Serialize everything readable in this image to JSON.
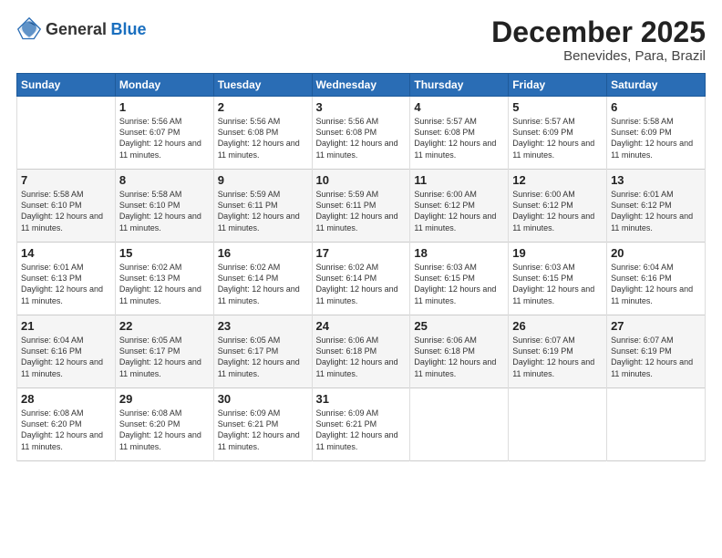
{
  "header": {
    "logo": {
      "general": "General",
      "blue": "Blue"
    },
    "title": "December 2025",
    "subtitle": "Benevides, Para, Brazil"
  },
  "calendar": {
    "weekdays": [
      "Sunday",
      "Monday",
      "Tuesday",
      "Wednesday",
      "Thursday",
      "Friday",
      "Saturday"
    ],
    "weeks": [
      [
        {
          "day": "",
          "sunrise": "",
          "sunset": "",
          "daylight": ""
        },
        {
          "day": "1",
          "sunrise": "Sunrise: 5:56 AM",
          "sunset": "Sunset: 6:07 PM",
          "daylight": "Daylight: 12 hours and 11 minutes."
        },
        {
          "day": "2",
          "sunrise": "Sunrise: 5:56 AM",
          "sunset": "Sunset: 6:08 PM",
          "daylight": "Daylight: 12 hours and 11 minutes."
        },
        {
          "day": "3",
          "sunrise": "Sunrise: 5:56 AM",
          "sunset": "Sunset: 6:08 PM",
          "daylight": "Daylight: 12 hours and 11 minutes."
        },
        {
          "day": "4",
          "sunrise": "Sunrise: 5:57 AM",
          "sunset": "Sunset: 6:08 PM",
          "daylight": "Daylight: 12 hours and 11 minutes."
        },
        {
          "day": "5",
          "sunrise": "Sunrise: 5:57 AM",
          "sunset": "Sunset: 6:09 PM",
          "daylight": "Daylight: 12 hours and 11 minutes."
        },
        {
          "day": "6",
          "sunrise": "Sunrise: 5:58 AM",
          "sunset": "Sunset: 6:09 PM",
          "daylight": "Daylight: 12 hours and 11 minutes."
        }
      ],
      [
        {
          "day": "7",
          "sunrise": "Sunrise: 5:58 AM",
          "sunset": "Sunset: 6:10 PM",
          "daylight": "Daylight: 12 hours and 11 minutes."
        },
        {
          "day": "8",
          "sunrise": "Sunrise: 5:58 AM",
          "sunset": "Sunset: 6:10 PM",
          "daylight": "Daylight: 12 hours and 11 minutes."
        },
        {
          "day": "9",
          "sunrise": "Sunrise: 5:59 AM",
          "sunset": "Sunset: 6:11 PM",
          "daylight": "Daylight: 12 hours and 11 minutes."
        },
        {
          "day": "10",
          "sunrise": "Sunrise: 5:59 AM",
          "sunset": "Sunset: 6:11 PM",
          "daylight": "Daylight: 12 hours and 11 minutes."
        },
        {
          "day": "11",
          "sunrise": "Sunrise: 6:00 AM",
          "sunset": "Sunset: 6:12 PM",
          "daylight": "Daylight: 12 hours and 11 minutes."
        },
        {
          "day": "12",
          "sunrise": "Sunrise: 6:00 AM",
          "sunset": "Sunset: 6:12 PM",
          "daylight": "Daylight: 12 hours and 11 minutes."
        },
        {
          "day": "13",
          "sunrise": "Sunrise: 6:01 AM",
          "sunset": "Sunset: 6:12 PM",
          "daylight": "Daylight: 12 hours and 11 minutes."
        }
      ],
      [
        {
          "day": "14",
          "sunrise": "Sunrise: 6:01 AM",
          "sunset": "Sunset: 6:13 PM",
          "daylight": "Daylight: 12 hours and 11 minutes."
        },
        {
          "day": "15",
          "sunrise": "Sunrise: 6:02 AM",
          "sunset": "Sunset: 6:13 PM",
          "daylight": "Daylight: 12 hours and 11 minutes."
        },
        {
          "day": "16",
          "sunrise": "Sunrise: 6:02 AM",
          "sunset": "Sunset: 6:14 PM",
          "daylight": "Daylight: 12 hours and 11 minutes."
        },
        {
          "day": "17",
          "sunrise": "Sunrise: 6:02 AM",
          "sunset": "Sunset: 6:14 PM",
          "daylight": "Daylight: 12 hours and 11 minutes."
        },
        {
          "day": "18",
          "sunrise": "Sunrise: 6:03 AM",
          "sunset": "Sunset: 6:15 PM",
          "daylight": "Daylight: 12 hours and 11 minutes."
        },
        {
          "day": "19",
          "sunrise": "Sunrise: 6:03 AM",
          "sunset": "Sunset: 6:15 PM",
          "daylight": "Daylight: 12 hours and 11 minutes."
        },
        {
          "day": "20",
          "sunrise": "Sunrise: 6:04 AM",
          "sunset": "Sunset: 6:16 PM",
          "daylight": "Daylight: 12 hours and 11 minutes."
        }
      ],
      [
        {
          "day": "21",
          "sunrise": "Sunrise: 6:04 AM",
          "sunset": "Sunset: 6:16 PM",
          "daylight": "Daylight: 12 hours and 11 minutes."
        },
        {
          "day": "22",
          "sunrise": "Sunrise: 6:05 AM",
          "sunset": "Sunset: 6:17 PM",
          "daylight": "Daylight: 12 hours and 11 minutes."
        },
        {
          "day": "23",
          "sunrise": "Sunrise: 6:05 AM",
          "sunset": "Sunset: 6:17 PM",
          "daylight": "Daylight: 12 hours and 11 minutes."
        },
        {
          "day": "24",
          "sunrise": "Sunrise: 6:06 AM",
          "sunset": "Sunset: 6:18 PM",
          "daylight": "Daylight: 12 hours and 11 minutes."
        },
        {
          "day": "25",
          "sunrise": "Sunrise: 6:06 AM",
          "sunset": "Sunset: 6:18 PM",
          "daylight": "Daylight: 12 hours and 11 minutes."
        },
        {
          "day": "26",
          "sunrise": "Sunrise: 6:07 AM",
          "sunset": "Sunset: 6:19 PM",
          "daylight": "Daylight: 12 hours and 11 minutes."
        },
        {
          "day": "27",
          "sunrise": "Sunrise: 6:07 AM",
          "sunset": "Sunset: 6:19 PM",
          "daylight": "Daylight: 12 hours and 11 minutes."
        }
      ],
      [
        {
          "day": "28",
          "sunrise": "Sunrise: 6:08 AM",
          "sunset": "Sunset: 6:20 PM",
          "daylight": "Daylight: 12 hours and 11 minutes."
        },
        {
          "day": "29",
          "sunrise": "Sunrise: 6:08 AM",
          "sunset": "Sunset: 6:20 PM",
          "daylight": "Daylight: 12 hours and 11 minutes."
        },
        {
          "day": "30",
          "sunrise": "Sunrise: 6:09 AM",
          "sunset": "Sunset: 6:21 PM",
          "daylight": "Daylight: 12 hours and 11 minutes."
        },
        {
          "day": "31",
          "sunrise": "Sunrise: 6:09 AM",
          "sunset": "Sunset: 6:21 PM",
          "daylight": "Daylight: 12 hours and 11 minutes."
        },
        {
          "day": "",
          "sunrise": "",
          "sunset": "",
          "daylight": ""
        },
        {
          "day": "",
          "sunrise": "",
          "sunset": "",
          "daylight": ""
        },
        {
          "day": "",
          "sunrise": "",
          "sunset": "",
          "daylight": ""
        }
      ]
    ]
  }
}
